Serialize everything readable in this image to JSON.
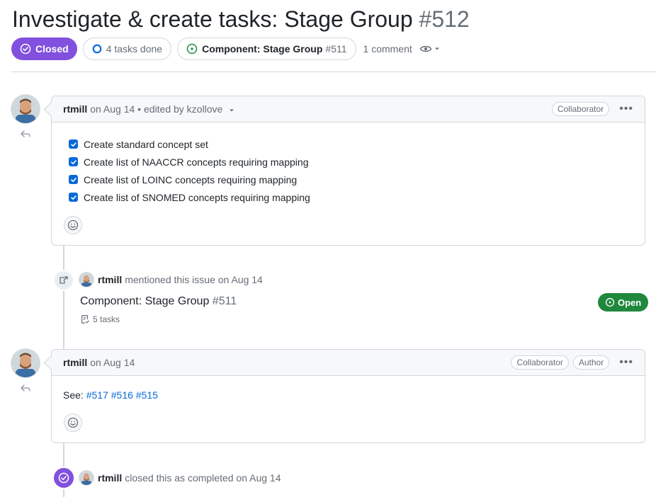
{
  "issue": {
    "title": "Investigate & create tasks: Stage Group",
    "number": "#512",
    "state": "Closed",
    "tasks_done": "4 tasks done",
    "linked_issue_title": "Component: Stage Group",
    "linked_issue_number": "#511",
    "comments_count": "1 comment"
  },
  "comment1": {
    "author": "rtmill",
    "meta": "on Aug 14 • edited by kzollove",
    "role_label": "Collaborator",
    "tasks": [
      {
        "label": "Create standard concept set",
        "checked": true
      },
      {
        "label": "Create list of NAACCR concepts requiring mapping",
        "checked": true
      },
      {
        "label": "Create list of LOINC concepts requiring mapping",
        "checked": true
      },
      {
        "label": "Create list of SNOMED concepts requiring mapping",
        "checked": true
      }
    ]
  },
  "mention_event": {
    "author": "rtmill",
    "text": "mentioned this issue on Aug 14",
    "ref_title": "Component: Stage Group",
    "ref_number": "#511",
    "ref_tasks": "5 tasks",
    "ref_state": "Open"
  },
  "comment2": {
    "author": "rtmill",
    "meta": "on Aug 14",
    "labels": [
      "Collaborator",
      "Author"
    ],
    "body_prefix": "See:",
    "links": [
      "#517",
      "#516",
      "#515"
    ]
  },
  "close_event": {
    "author": "rtmill",
    "text": "closed this as completed on Aug 14"
  },
  "colors": {
    "closed_purple": "#8250df",
    "open_green": "#1f883d",
    "link_blue": "#0969da",
    "border": "#d0d7de"
  }
}
